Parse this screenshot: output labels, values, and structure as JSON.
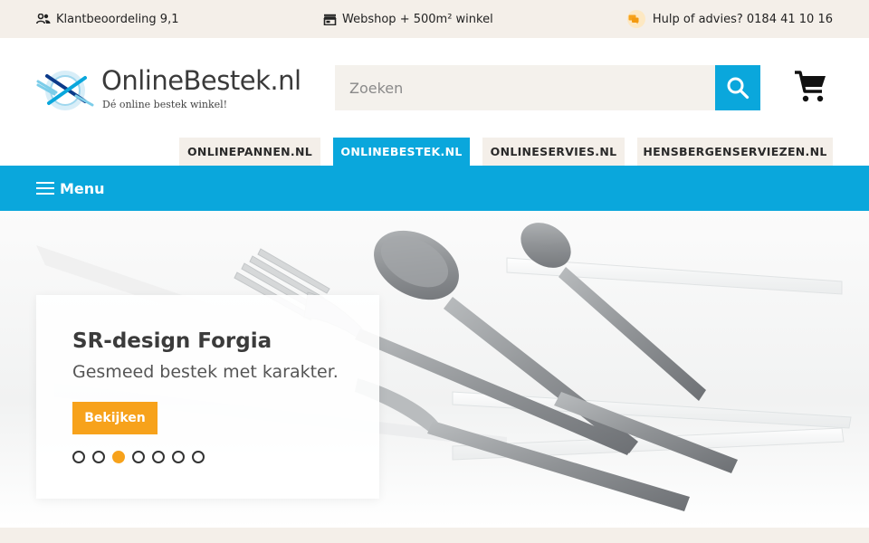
{
  "topbar": {
    "rating": "Klantbeoordeling 9,1",
    "shop": "Webshop + 500m² winkel",
    "help": "Hulp of advies? 0184 41 10 16"
  },
  "logo": {
    "name": "OnlineBestek.nl",
    "tagline": "Dé online bestek winkel!"
  },
  "search": {
    "placeholder": "Zoeken",
    "value": ""
  },
  "store_tabs": [
    {
      "label": "ONLINEPANNEN.NL",
      "active": false
    },
    {
      "label": "ONLINEBESTEK.NL",
      "active": true
    },
    {
      "label": "ONLINESERVIES.NL",
      "active": false
    },
    {
      "label": "HENSBERGENSERVIEZEN.NL",
      "active": false
    }
  ],
  "menu": {
    "label": "Menu"
  },
  "hero": {
    "title": "SR-design Forgia",
    "subtitle": "Gesmeed bestek met karakter.",
    "cta": "Bekijken",
    "slide_count": 7,
    "active_slide": 3
  },
  "colors": {
    "accent_blue": "#0aa7dc",
    "accent_orange": "#f7a21b",
    "beige": "#f4efe9"
  },
  "icons": [
    "people-icon",
    "store-icon",
    "chat-icon",
    "search-icon",
    "cart-icon",
    "menu-icon"
  ]
}
